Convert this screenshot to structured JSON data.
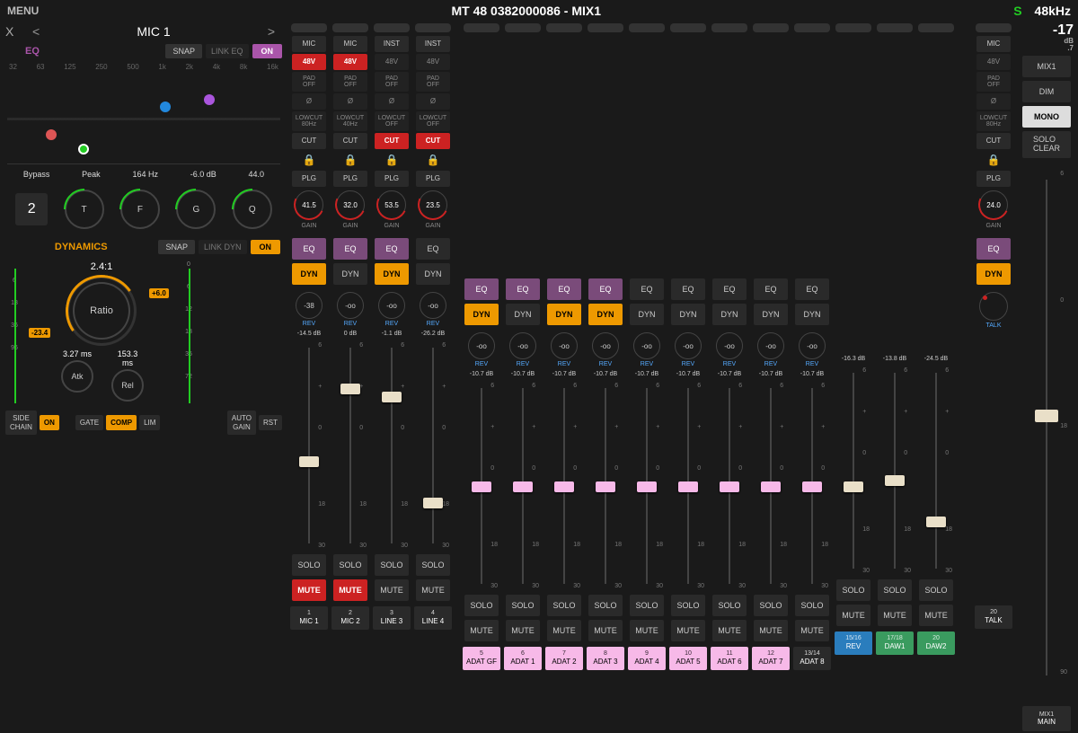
{
  "header": {
    "menu": "MENU",
    "title": "MT 48 0382000086 - MIX1",
    "solo": "S",
    "sample_rate": "48kHz"
  },
  "eq_panel": {
    "close": "X",
    "prev": "<",
    "channel": "MIC 1",
    "next": ">",
    "label": "EQ",
    "snap": "SNAP",
    "link": "LINK EQ",
    "on": "ON",
    "freqs": [
      "32",
      "63",
      "125",
      "250",
      "500",
      "1k",
      "2k",
      "4k",
      "8k",
      "16k"
    ],
    "vals": {
      "bypass": "Bypass",
      "type": "Peak",
      "freq": "164 Hz",
      "gain": "-6.0 dB",
      "q": "44.0"
    },
    "band": "2",
    "knobs": {
      "t": "T",
      "f": "F",
      "g": "G",
      "q": "Q"
    }
  },
  "dyn_panel": {
    "label": "DYNAMICS",
    "snap": "SNAP",
    "link": "LINK DYN",
    "on": "ON",
    "ratio_val": "2.4:1",
    "ratio": "Ratio",
    "thr": "-23.4",
    "mk": "+6.0",
    "atk_val": "3.27 ms",
    "atk": "Atk",
    "rel_val": "153.3 ms",
    "rel": "Rel",
    "scale1": [
      "",
      "6",
      "18",
      "36",
      "96"
    ],
    "scale2": [
      "0",
      "6",
      "12",
      "18",
      "36",
      "72"
    ],
    "btns": {
      "side": "SIDE\nCHAIN",
      "on": "ON",
      "gate": "GATE",
      "comp": "COMP",
      "lim": "LIM",
      "auto": "AUTO\nGAIN",
      "rst": "RST"
    }
  },
  "strip_common": {
    "mic": "MIC",
    "inst": "INST",
    "p48": "48V",
    "pad": "PAD\nOFF",
    "phase": "Ø",
    "lowcut80": "LOWCUT\n80Hz",
    "lowcut40": "LOWCUT\n40Hz",
    "lowcutoff": "LOWCUT\nOFF",
    "cut": "CUT",
    "plg": "PLG",
    "gain": "GAIN",
    "eq": "EQ",
    "dyn": "DYN",
    "rev": "REV",
    "solo": "SOLO",
    "mute": "MUTE",
    "talk": "TALK",
    "fader_ticks": [
      "6",
      "+",
      "0",
      "",
      "18",
      "30"
    ]
  },
  "strips": [
    {
      "num": "1",
      "name": "MIC 1",
      "gain": "41.5",
      "rev": "-38",
      "level": "-14.5 dB",
      "mute": true,
      "eq": true,
      "dyn": true,
      "input": true,
      "p48": true,
      "lowcut": "80Hz",
      "fader": 55,
      "color": ""
    },
    {
      "num": "2",
      "name": "MIC 2",
      "gain": "32.0",
      "rev": "-oo",
      "level": "0 dB",
      "mute": true,
      "eq": true,
      "dyn": false,
      "input": true,
      "p48": true,
      "lowcut": "40Hz",
      "fader": 20,
      "color": ""
    },
    {
      "num": "3",
      "name": "LINE 3",
      "gain": "53.5",
      "rev": "-oo",
      "level": "-1.1 dB",
      "mute": false,
      "eq": true,
      "dyn": true,
      "input": true,
      "inst": true,
      "cutred": true,
      "lowcut": "OFF",
      "fader": 24,
      "color": ""
    },
    {
      "num": "4",
      "name": "LINE 4",
      "gain": "23.5",
      "rev": "-oo",
      "level": "-26.2 dB",
      "mute": false,
      "eq": false,
      "dyn": false,
      "input": true,
      "inst": true,
      "cutred": true,
      "lowcut": "OFF",
      "fader": 75,
      "color": ""
    },
    {
      "num": "5",
      "name": "ADAT GF",
      "rev": "-oo",
      "level": "-10.7 dB",
      "mute": false,
      "eq": true,
      "dyn": true,
      "fader": 48,
      "color": "pink",
      "pinkcap": true
    },
    {
      "num": "6",
      "name": "ADAT 1",
      "rev": "-oo",
      "level": "-10.7 dB",
      "mute": false,
      "eq": true,
      "dyn": false,
      "fader": 48,
      "color": "pink",
      "pinkcap": true
    },
    {
      "num": "7",
      "name": "ADAT 2",
      "rev": "-oo",
      "level": "-10.7 dB",
      "mute": false,
      "eq": true,
      "dyn": true,
      "fader": 48,
      "color": "pink",
      "pinkcap": true
    },
    {
      "num": "8",
      "name": "ADAT 3",
      "rev": "-oo",
      "level": "-10.7 dB",
      "mute": false,
      "eq": true,
      "dyn": true,
      "fader": 48,
      "color": "pink",
      "pinkcap": true
    },
    {
      "num": "9",
      "name": "ADAT 4",
      "rev": "-oo",
      "level": "-10.7 dB",
      "mute": false,
      "eq": false,
      "dyn": false,
      "fader": 48,
      "color": "pink",
      "pinkcap": true
    },
    {
      "num": "10",
      "name": "ADAT 5",
      "rev": "-oo",
      "level": "-10.7 dB",
      "mute": false,
      "eq": false,
      "dyn": false,
      "fader": 48,
      "color": "pink",
      "pinkcap": true
    },
    {
      "num": "11",
      "name": "ADAT 6",
      "rev": "-oo",
      "level": "-10.7 dB",
      "mute": false,
      "eq": false,
      "dyn": false,
      "fader": 48,
      "color": "pink",
      "pinkcap": true
    },
    {
      "num": "12",
      "name": "ADAT 7",
      "rev": "-oo",
      "level": "-10.7 dB",
      "mute": false,
      "eq": false,
      "dyn": false,
      "fader": 48,
      "color": "pink",
      "pinkcap": true
    },
    {
      "num": "13/14",
      "name": "ADAT 8",
      "rev": "-oo",
      "level": "-10.7 dB",
      "mute": false,
      "eq": false,
      "dyn": false,
      "fader": 48,
      "color": "",
      "pinkcap": true
    },
    {
      "num": "15/16",
      "name": "REV",
      "level": "-16.3 dB",
      "mute": false,
      "fader": 55,
      "color": "blue"
    },
    {
      "num": "17/18",
      "name": "DAW1",
      "level": "-13.8 dB",
      "mute": false,
      "fader": 52,
      "color": "green"
    },
    {
      "num": "20",
      "name": "DAW2",
      "level": "-24.5 dB",
      "mute": false,
      "fader": 72,
      "color": "green"
    }
  ],
  "talk_strip": {
    "gain": "24.0",
    "lowcut": "80Hz",
    "name": "TALK",
    "num": "20",
    "eq": true,
    "dyn": true
  },
  "right": {
    "level": "-17",
    "unit": "dB",
    "sub": ".7",
    "mix1": "MIX1",
    "dim": "DIM",
    "mono": "MONO",
    "soloclear": "SOLO\nCLEAR",
    "main_num": "MIX1",
    "main": "MAIN",
    "ticks": [
      "6",
      "0",
      "18",
      "",
      "90"
    ]
  }
}
